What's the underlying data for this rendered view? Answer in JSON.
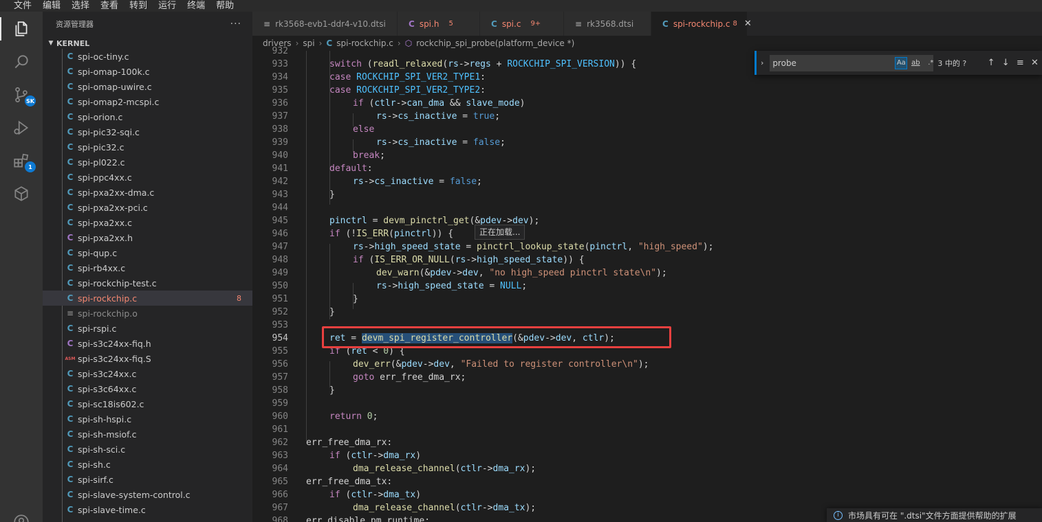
{
  "menu": [
    "文件",
    "编辑",
    "选择",
    "查看",
    "转到",
    "运行",
    "终端",
    "帮助"
  ],
  "activity": {
    "scm_badge": "SK",
    "extensions_badge": "1"
  },
  "explorer": {
    "title": "资源管理器",
    "more": "···",
    "section": "KERNEL",
    "files": [
      {
        "icon": "C",
        "name": "spi-oc-tiny.c"
      },
      {
        "icon": "C",
        "name": "spi-omap-100k.c"
      },
      {
        "icon": "C",
        "name": "spi-omap-uwire.c"
      },
      {
        "icon": "C",
        "name": "spi-omap2-mcspi.c"
      },
      {
        "icon": "C",
        "name": "spi-orion.c"
      },
      {
        "icon": "C",
        "name": "spi-pic32-sqi.c"
      },
      {
        "icon": "C",
        "name": "spi-pic32.c"
      },
      {
        "icon": "C",
        "name": "spi-pl022.c"
      },
      {
        "icon": "C",
        "name": "spi-ppc4xx.c"
      },
      {
        "icon": "C",
        "name": "spi-pxa2xx-dma.c"
      },
      {
        "icon": "C",
        "name": "spi-pxa2xx-pci.c"
      },
      {
        "icon": "C",
        "name": "spi-pxa2xx.c"
      },
      {
        "icon": "C",
        "name": "spi-pxa2xx.h"
      },
      {
        "icon": "C",
        "name": "spi-qup.c"
      },
      {
        "icon": "C",
        "name": "spi-rb4xx.c"
      },
      {
        "icon": "C",
        "name": "spi-rockchip-test.c"
      },
      {
        "icon": "C",
        "name": "spi-rockchip.c",
        "count": "8"
      },
      {
        "icon": "≡",
        "name": "spi-rockchip.o"
      },
      {
        "icon": "C",
        "name": "spi-rspi.c"
      },
      {
        "icon": "C",
        "name": "spi-s3c24xx-fiq.h"
      },
      {
        "icon": "ASM",
        "name": "spi-s3c24xx-fiq.S"
      },
      {
        "icon": "C",
        "name": "spi-s3c24xx.c"
      },
      {
        "icon": "C",
        "name": "spi-s3c64xx.c"
      },
      {
        "icon": "C",
        "name": "spi-sc18is602.c"
      },
      {
        "icon": "C",
        "name": "spi-sh-hspi.c"
      },
      {
        "icon": "C",
        "name": "spi-sh-msiof.c"
      },
      {
        "icon": "C",
        "name": "spi-sh-sci.c"
      },
      {
        "icon": "C",
        "name": "spi-sh.c"
      },
      {
        "icon": "C",
        "name": "spi-sirf.c"
      },
      {
        "icon": "C",
        "name": "spi-slave-system-control.c"
      },
      {
        "icon": "C",
        "name": "spi-slave-time.c"
      }
    ]
  },
  "tabs": [
    {
      "icon": "≡",
      "name": "rk3568-evb1-ddr4-v10.dtsi",
      "count": ""
    },
    {
      "icon": "C",
      "name": "spi.h",
      "count": "5"
    },
    {
      "icon": "C",
      "name": "spi.c",
      "count": "9+"
    },
    {
      "icon": "≡",
      "name": "rk3568.dtsi",
      "count": ""
    },
    {
      "icon": "C",
      "name": "spi-rockchip.c",
      "count": "8",
      "close": "✕"
    }
  ],
  "breadcrumb": {
    "p1": "drivers",
    "p2": "spi",
    "file_icon": "C",
    "file": "spi-rockchip.c",
    "symbol": "rockchip_spi_probe(platform_device *)"
  },
  "find": {
    "query": "probe",
    "match_case": "Aa",
    "whole_word": "ab",
    "regex": ".*",
    "result": "3 中的 ?",
    "prev": "↑",
    "next": "↓",
    "selection": "≡",
    "close": "✕"
  },
  "hover": "正在加载...",
  "notification": "市场具有可在 \".dtsi\"文件方面提供帮助的扩展",
  "code": {
    "top_partial": "932",
    "lines": [
      "933",
      "934",
      "935",
      "936",
      "937",
      "938",
      "939",
      "940",
      "941",
      "942",
      "943",
      "944",
      "945",
      "946",
      "947",
      "948",
      "949",
      "950",
      "951",
      "952",
      "953",
      "954",
      "955",
      "956",
      "957",
      "958",
      "959",
      "960",
      "961",
      "962",
      "963",
      "964",
      "965",
      "966",
      "967",
      "968"
    ],
    "t": {
      "k_switch": "switch",
      "f_readl": "readl_relaxed",
      "v_rs": "rs",
      "v_regs": "regs",
      "c_ver": "ROCKCHIP_SPI_VERSION",
      "k_case": "case",
      "c_t1": "ROCKCHIP_SPI_VER2_TYPE1",
      "c_t2": "ROCKCHIP_SPI_VER2_TYPE2",
      "k_if": "if",
      "v_ctlr": "ctlr",
      "v_can_dma": "can_dma",
      "v_slave": "slave_mode",
      "v_cs": "cs_inactive",
      "b_true": "true",
      "k_else": "else",
      "b_false": "false",
      "k_break": "break",
      "k_default": "default",
      "v_pinctrl": "pinctrl",
      "f_getpin": "devm_pinctrl_get",
      "v_pdev": "pdev",
      "v_dev": "dev",
      "f_iserr": "IS_ERR",
      "v_hss": "high_speed_state",
      "f_lookup": "pinctrl_lookup_state",
      "s_hs": "\"high_speed\"",
      "f_iserrnull": "IS_ERR_OR_NULL",
      "f_warn": "dev_warn",
      "s_warn": "\"no high_speed pinctrl state\\n\"",
      "c_null": "NULL",
      "v_ret": "ret",
      "f_reg": "devm_spi_register_controller",
      "n_zero": "0",
      "f_err": "dev_err",
      "s_err": "\"Failed to register controller\\n\"",
      "k_goto": "goto",
      "l_rx": "err_free_dma_rx",
      "k_return": "return",
      "v_dma_rx": "dma_rx",
      "f_release": "dma_release_channel",
      "l_tx": "err_free_dma_tx",
      "v_dma_tx": "dma_tx",
      "l_pm": "err_disable_pm_runtime"
    }
  }
}
